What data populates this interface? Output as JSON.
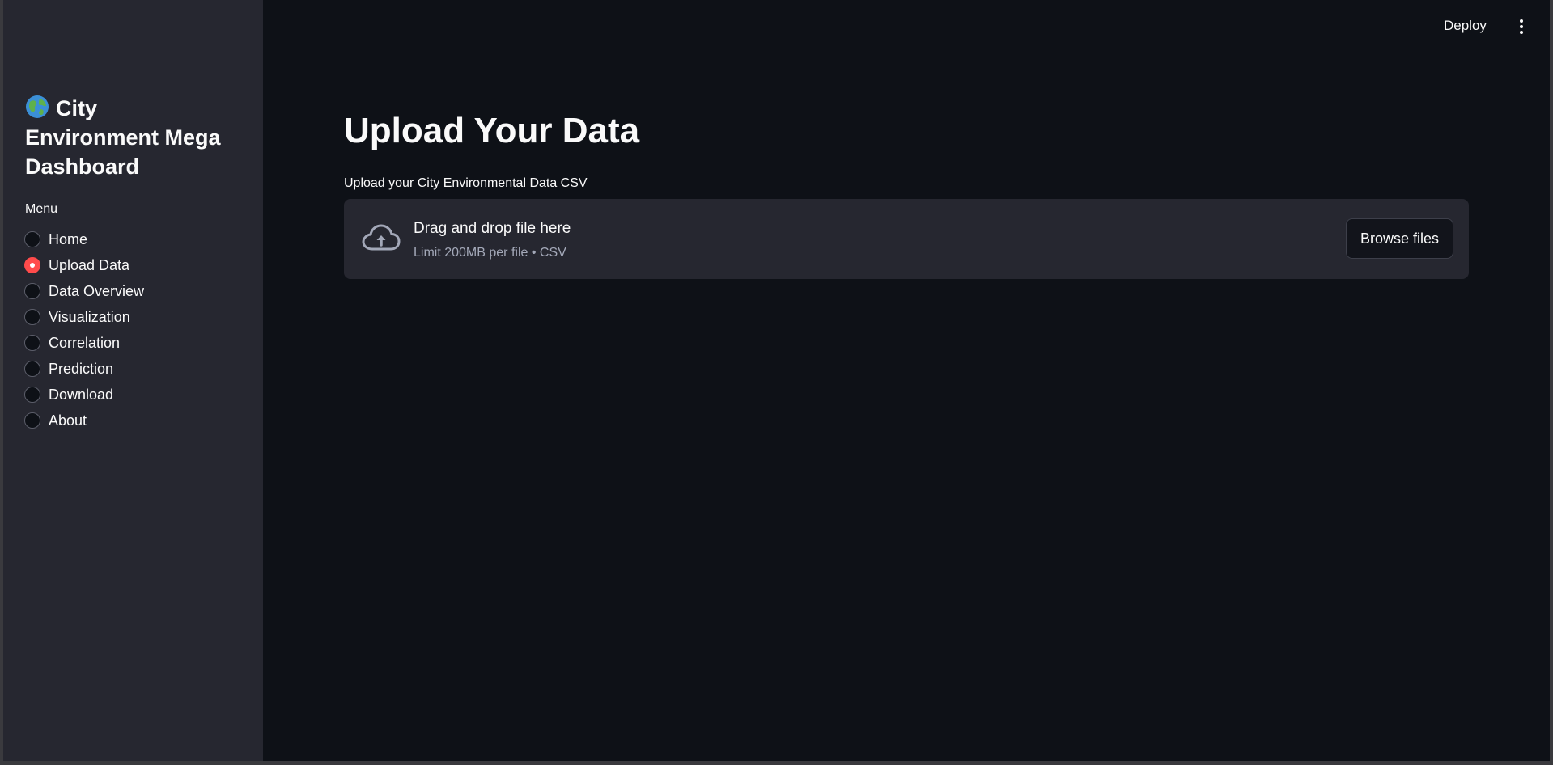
{
  "sidebar": {
    "title": "City Environment Mega Dashboard",
    "title_icon": "globe-icon",
    "menu_label": "Menu",
    "items": [
      {
        "label": "Home",
        "selected": false
      },
      {
        "label": "Upload Data",
        "selected": true
      },
      {
        "label": "Data Overview",
        "selected": false
      },
      {
        "label": "Visualization",
        "selected": false
      },
      {
        "label": "Correlation",
        "selected": false
      },
      {
        "label": "Prediction",
        "selected": false
      },
      {
        "label": "Download",
        "selected": false
      },
      {
        "label": "About",
        "selected": false
      }
    ]
  },
  "topbar": {
    "deploy_label": "Deploy",
    "menu_icon": "kebab-menu-icon"
  },
  "main": {
    "title": "Upload Your Data",
    "uploader": {
      "label": "Upload your City Environmental Data CSV",
      "drop_text": "Drag and drop file here",
      "limit_text": "Limit 200MB per file • CSV",
      "button_label": "Browse files",
      "icon": "cloud-upload-icon"
    }
  },
  "colors": {
    "background": "#0e1117",
    "sidebar": "#262730",
    "accent": "#ff4b4b",
    "text": "#fafafa",
    "muted_text": "#a3a8b8"
  }
}
